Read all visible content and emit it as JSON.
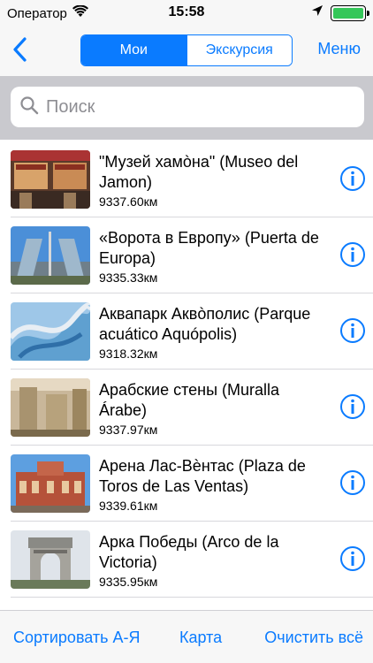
{
  "status_bar": {
    "carrier": "Оператор",
    "time": "15:58",
    "battery_level": 1.0
  },
  "nav": {
    "segments": [
      "Мои",
      "Экскурсия"
    ],
    "selected_segment": 0,
    "menu_label": "Меню"
  },
  "search": {
    "placeholder": "Поиск",
    "value": ""
  },
  "places": [
    {
      "title": "\"Музей хамòна\" (Museo del Jamon)",
      "distance": "9337.60км"
    },
    {
      "title": "«Ворота в Европу» (Puerta de Europa)",
      "distance": "9335.33км"
    },
    {
      "title": "Аквапарк Аквòполис (Parque acuático Aquópolis)",
      "distance": "9318.32км"
    },
    {
      "title": "Арабские стены (Muralla Árabe)",
      "distance": "9337.97км"
    },
    {
      "title": "Арена Лас-Вѐнтас (Plaza de Toros de Las Ventas)",
      "distance": "9339.61км"
    },
    {
      "title": "Арка Победы (Arco de la Victoria)",
      "distance": "9335.95км"
    }
  ],
  "toolbar": {
    "sort_label": "Сортировать А-Я",
    "map_label": "Карта",
    "clear_label": "Очистить всё"
  },
  "colors": {
    "accent": "#0a7bff",
    "bar_background": "#f7f7f7",
    "search_background": "#c9c9ce",
    "battery": "#34c759"
  }
}
